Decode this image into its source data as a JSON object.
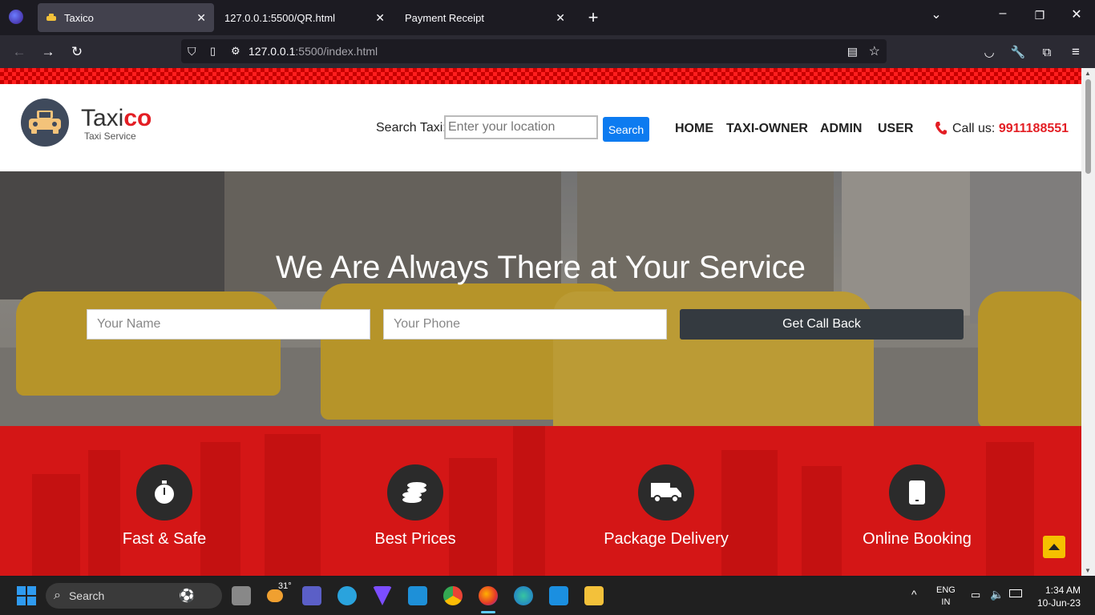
{
  "browser": {
    "tabs": [
      {
        "label": "Taxico",
        "active": true
      },
      {
        "label": "127.0.0.1:5500/QR.html",
        "active": false
      },
      {
        "label": "Payment Receipt",
        "active": false
      }
    ],
    "url_host": "127.0.0.1",
    "url_path": ":5500/index.html"
  },
  "header": {
    "brand_main": "Taxi",
    "brand_accent": "co",
    "tagline": "Taxi Service",
    "search_label": "Search Taxi:",
    "search_placeholder": "Enter your location",
    "search_button": "Search",
    "nav": [
      "HOME",
      "TAXI-OWNER",
      "ADMIN",
      "USER"
    ],
    "call_label": "Call us:",
    "call_number": "9911188551"
  },
  "hero": {
    "title": "We Are Always There at Your Service",
    "name_placeholder": "Your Name",
    "phone_placeholder": "Your Phone",
    "callback_button": "Get Call Back"
  },
  "features": [
    {
      "label": "Fast & Safe",
      "icon": "stopwatch-icon"
    },
    {
      "label": "Best Prices",
      "icon": "coins-icon"
    },
    {
      "label": "Package Delivery",
      "icon": "truck-icon"
    },
    {
      "label": "Online Booking",
      "icon": "mobile-icon"
    }
  ],
  "taskbar": {
    "search_label": "Search",
    "weather_temp": "31°",
    "lang_top": "ENG",
    "lang_bottom": "IN",
    "time": "1:34 AM",
    "date": "10-Jun-23"
  },
  "colors": {
    "accent_red": "#e31e24",
    "feature_bg": "#d41616",
    "search_blue": "#0d7bf0"
  }
}
